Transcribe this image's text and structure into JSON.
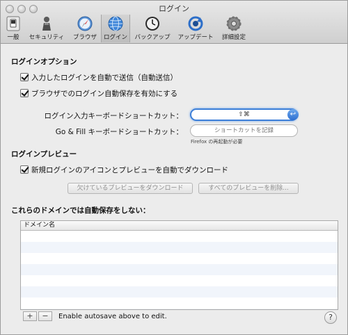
{
  "window": {
    "title": "ログイン"
  },
  "toolbar": {
    "items": [
      {
        "label": "一般",
        "icon": "switch-icon"
      },
      {
        "label": "セキュリティ",
        "icon": "security-icon"
      },
      {
        "label": "ブラウザ",
        "icon": "compass-icon"
      },
      {
        "label": "ログイン",
        "icon": "globe-icon"
      },
      {
        "label": "バックアップ",
        "icon": "clock-icon"
      },
      {
        "label": "アップデート",
        "icon": "update-icon"
      },
      {
        "label": "詳細設定",
        "icon": "gear-icon"
      }
    ],
    "selected": "ログイン"
  },
  "login_options": {
    "title": "ログインオプション",
    "auto_submit": {
      "label": "入力したログインを自動で送信（自動送信）",
      "checked": true
    },
    "browser_autosave": {
      "label": "ブラウザでのログイン自動保存を有効にする",
      "checked": true
    },
    "shortcut_fill_label": "ログイン入力キーボードショートカット：",
    "shortcut_fill_value": "⇧⌘",
    "shortcut_gofill_label": "Go & Fill キーボードショートカット：",
    "shortcut_gofill_placeholder": "ショートカットを記録",
    "restart_note": "Firefox の再起動が必要"
  },
  "login_preview": {
    "title": "ログインプレビュー",
    "auto_download": {
      "label": "新規ログインのアイコンとプレビューを自動でダウンロード",
      "checked": true
    },
    "download_missing_button": "欠けているプレビューをダウンロード",
    "delete_all_button": "すべてのプレビューを削除..."
  },
  "domains": {
    "title": "これらのドメインでは自動保存をしない：",
    "column_header": "ドメイン名",
    "rows": []
  },
  "footer": {
    "add_button": "+",
    "remove_button": "−",
    "text": "Enable autosave above to edit.",
    "help_button": "?"
  }
}
